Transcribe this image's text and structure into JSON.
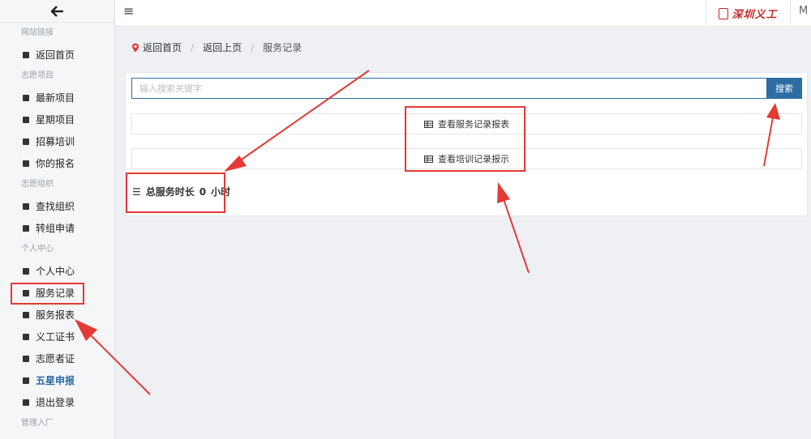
{
  "sidebar": {
    "back_icon": "arrow-left-icon",
    "groups": [
      {
        "title": "网站链接",
        "items": [
          {
            "label": "返回首页"
          }
        ]
      },
      {
        "title": "志愿项目",
        "items": [
          {
            "label": "最新项目"
          },
          {
            "label": "星期项目"
          },
          {
            "label": "招募培训"
          },
          {
            "label": "你的报名"
          }
        ]
      },
      {
        "title": "志愿组织",
        "items": [
          {
            "label": "查找组织"
          },
          {
            "label": "转组申请"
          }
        ]
      },
      {
        "title": "个人中心",
        "items": [
          {
            "label": "个人中心"
          },
          {
            "label": "服务记录"
          },
          {
            "label": "服务报表"
          },
          {
            "label": "义工证书"
          },
          {
            "label": "志愿者证"
          },
          {
            "label": "五星申报"
          },
          {
            "label": "退出登录"
          }
        ]
      },
      {
        "title": "管理入厂",
        "items": []
      }
    ]
  },
  "topbar": {
    "menu_icon": "hamburger-icon",
    "brand": "深圳义工",
    "user_initial": "M"
  },
  "breadcrumb": {
    "items": [
      "返回首页",
      "返回上页"
    ],
    "current": "服务记录"
  },
  "search": {
    "placeholder": "输入搜索关键字",
    "value": "",
    "button": "搜索"
  },
  "actions": {
    "view_service_report": "查看服务记录报表",
    "view_training_report": "查看培训记录报示"
  },
  "summary": {
    "label": "总服务时长",
    "value": "0",
    "unit": "小时"
  },
  "colors": {
    "primary": "#2d6da3",
    "annotation": "#e53935",
    "brand": "#c62828",
    "highlight_link": "#2c6aa6"
  }
}
